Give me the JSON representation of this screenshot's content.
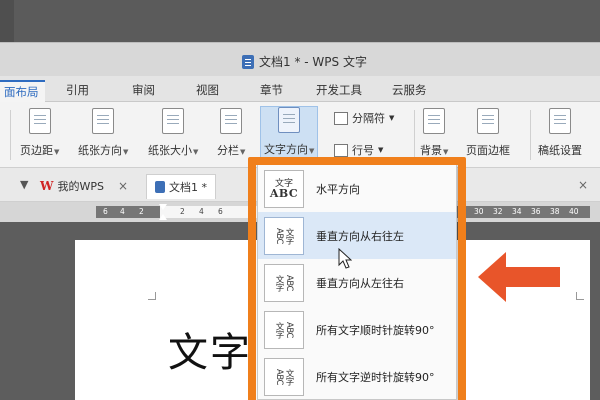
{
  "window": {
    "title": "文档1 * - WPS 文字"
  },
  "ribbon_tabs": [
    "面布局",
    "引用",
    "审阅",
    "视图",
    "章节",
    "开发工具",
    "云服务"
  ],
  "ribbon": {
    "margins": "页边距",
    "orientation": "纸张方向",
    "size": "纸张大小",
    "columns": "分栏",
    "text_direction": "文字方向",
    "separator": "分隔符",
    "line_number": "行号",
    "background": "背景",
    "page_border": "页面边框",
    "grid_settings": "稿纸设置"
  },
  "doc_tabs": {
    "home": "我的WPS",
    "doc": "文档1 *",
    "close": "×"
  },
  "ruler": {
    "left": [
      "6",
      "4",
      "2",
      "2",
      "4",
      "6"
    ],
    "right": [
      "30",
      "32",
      "34",
      "36",
      "38",
      "40"
    ]
  },
  "document": {
    "visible_text": "文字"
  },
  "text_direction_menu": {
    "items": [
      {
        "label": "水平方向",
        "icon_top": "文字",
        "icon_bottom": "ABC"
      },
      {
        "label": "垂直方向从右往左",
        "icon_left": "ABC",
        "icon_right": "文字"
      },
      {
        "label": "垂直方向从左往右",
        "icon_left": "文字",
        "icon_right": "ABC"
      },
      {
        "label": "所有文字顺时针旋转90°",
        "icon_left": "文字",
        "icon_right": "ABC"
      },
      {
        "label": "所有文字逆时针旋转90°",
        "icon_left": "ABC",
        "icon_right": "文字"
      }
    ],
    "hovered_index": 1
  },
  "colors": {
    "highlight_border": "#f07f1b",
    "accent_blue": "#2f6cc0",
    "menu_hover": "#dbe8f7"
  }
}
